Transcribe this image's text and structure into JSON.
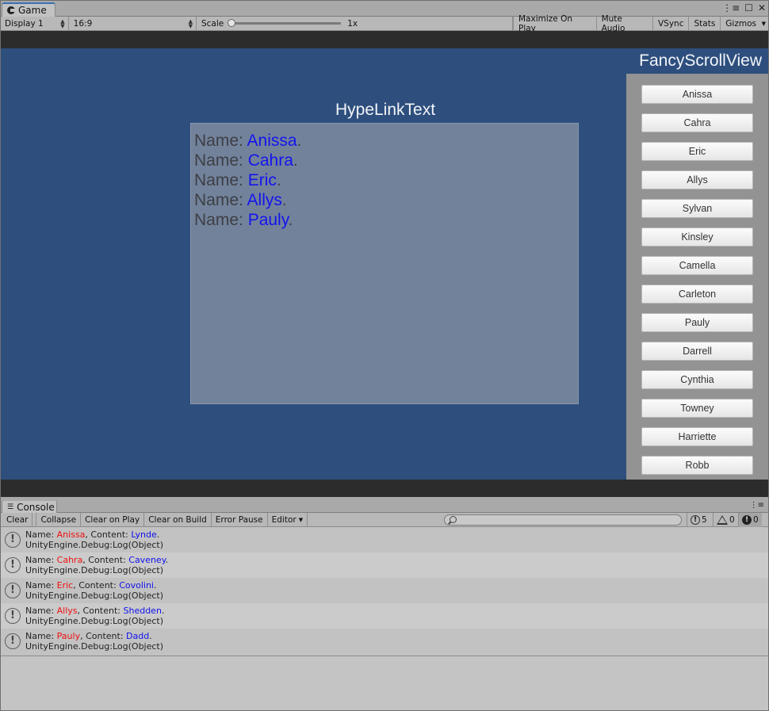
{
  "game_window": {
    "tab_label": "Game",
    "toolbar": {
      "display": "Display 1",
      "aspect": "16:9",
      "scale_label": "Scale",
      "scale_value": "1x",
      "scale_level": 0.0,
      "maximize_on_play": "Maximize On Play",
      "mute_audio": "Mute Audio",
      "vsync": "VSync",
      "stats": "Stats",
      "gizmos": "Gizmos"
    },
    "colors": {
      "game_background": "#2e4f7e",
      "hype_panel": "#72829b",
      "link_color": "#1414ee",
      "fancy_panel": "#939393"
    }
  },
  "hype_link": {
    "title": "HypeLinkText",
    "lines": [
      {
        "prefix": "Name: ",
        "name": "Anissa",
        "suffix": "."
      },
      {
        "prefix": "Name: ",
        "name": "Cahra",
        "suffix": "."
      },
      {
        "prefix": "Name: ",
        "name": "Eric",
        "suffix": "."
      },
      {
        "prefix": "Name: ",
        "name": "Allys",
        "suffix": "."
      },
      {
        "prefix": "Name: ",
        "name": "Pauly",
        "suffix": "."
      }
    ]
  },
  "fancy_scroll": {
    "title": "FancyScrollView",
    "items": [
      "Anissa",
      "Cahra",
      "Eric",
      "Allys",
      "Sylvan",
      "Kinsley",
      "Camella",
      "Carleton",
      "Pauly",
      "Darrell",
      "Cynthia",
      "Towney",
      "Harriette",
      "Robb"
    ]
  },
  "console_window": {
    "tab_label": "Console",
    "toolbar": {
      "clear": "Clear",
      "collapse": "Collapse",
      "clear_on_play": "Clear on Play",
      "clear_on_build": "Clear on Build",
      "error_pause": "Error Pause",
      "editor": "Editor",
      "info_count": "5",
      "warning_count": "0",
      "error_count": "0"
    },
    "entries": [
      {
        "label": "Name: ",
        "name": "Anissa",
        "mid": ", Content: ",
        "content": "Lynde",
        "end": ".",
        "trace": "UnityEngine.Debug:Log(Object)"
      },
      {
        "label": "Name: ",
        "name": "Cahra",
        "mid": ", Content: ",
        "content": "Caveney",
        "end": ".",
        "trace": "UnityEngine.Debug:Log(Object)"
      },
      {
        "label": "Name: ",
        "name": "Eric",
        "mid": ", Content: ",
        "content": "Covolini",
        "end": ".",
        "trace": "UnityEngine.Debug:Log(Object)"
      },
      {
        "label": "Name: ",
        "name": "Allys",
        "mid": ", Content: ",
        "content": "Shedden",
        "end": ".",
        "trace": "UnityEngine.Debug:Log(Object)"
      },
      {
        "label": "Name: ",
        "name": "Pauly",
        "mid": ", Content: ",
        "content": "Dadd",
        "end": ".",
        "trace": "UnityEngine.Debug:Log(Object)"
      }
    ]
  }
}
